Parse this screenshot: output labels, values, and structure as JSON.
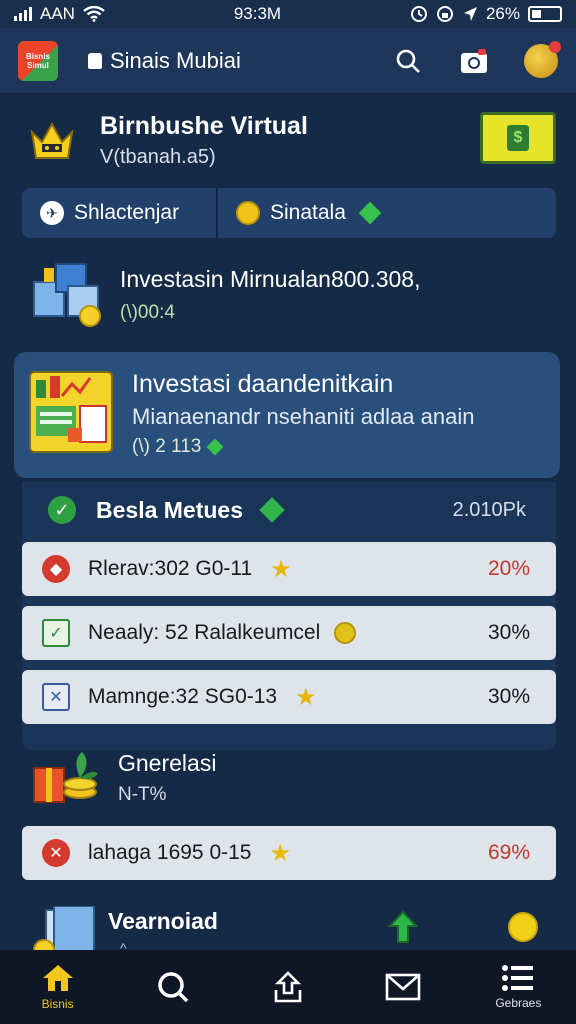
{
  "status": {
    "carrier": "AAN",
    "time": "93:3M",
    "battery": "26%"
  },
  "appbar": {
    "logo_text": "Bisnis Simul",
    "title": "Sinais Mubiai"
  },
  "profile": {
    "name": "Birnbushe Virtual",
    "subtitle": "V(tbanah.a5)"
  },
  "segment": {
    "left_label": "Shlactenjar",
    "right_label": "Sinatala"
  },
  "invest_summary": {
    "title": "Investasin Mirnualan800.308,",
    "value": "(\\)00:4"
  },
  "investasi_card": {
    "title": "Investasi daandenitkain",
    "description": "Mianaenandr nsehaniti adlaa anain",
    "value": "(\\) 2 113"
  },
  "metrics": {
    "title": "Besla Metues",
    "total": "2.010Pk",
    "rows": [
      {
        "icon": "error-diamond-icon",
        "label": "Rlerav:302 G0-11",
        "badge": "star",
        "percent": "20%",
        "percent_color": "#c0392b"
      },
      {
        "icon": "check-box-icon",
        "label": "Neaaly: 52 Ralalkeumcel",
        "badge": "coin",
        "percent": "30%",
        "percent_color": "#1a1a1a"
      },
      {
        "icon": "close-box-icon",
        "label": "Mamnge:32 SG0-13",
        "badge": "star",
        "percent": "30%",
        "percent_color": "#1a1a1a"
      }
    ]
  },
  "generasi": {
    "title": "Gnerelasi",
    "subtitle": "N-T%",
    "row": {
      "icon": "error-circle-icon",
      "label": "lahaga 1695 0-15",
      "badge": "star",
      "percent": "69%",
      "percent_color": "#c0392b"
    }
  },
  "download": {
    "title": "Vearnoiad"
  },
  "tabs": [
    {
      "name": "home",
      "label": "Bisnis"
    },
    {
      "name": "search",
      "label": ""
    },
    {
      "name": "share",
      "label": ""
    },
    {
      "name": "mail",
      "label": ""
    },
    {
      "name": "menu",
      "label": "Gebraes"
    }
  ],
  "colors": {
    "background": "#152a47",
    "accent_yellow": "#f2c61d",
    "card": "#294f7c",
    "row": "#dfe3ea"
  }
}
